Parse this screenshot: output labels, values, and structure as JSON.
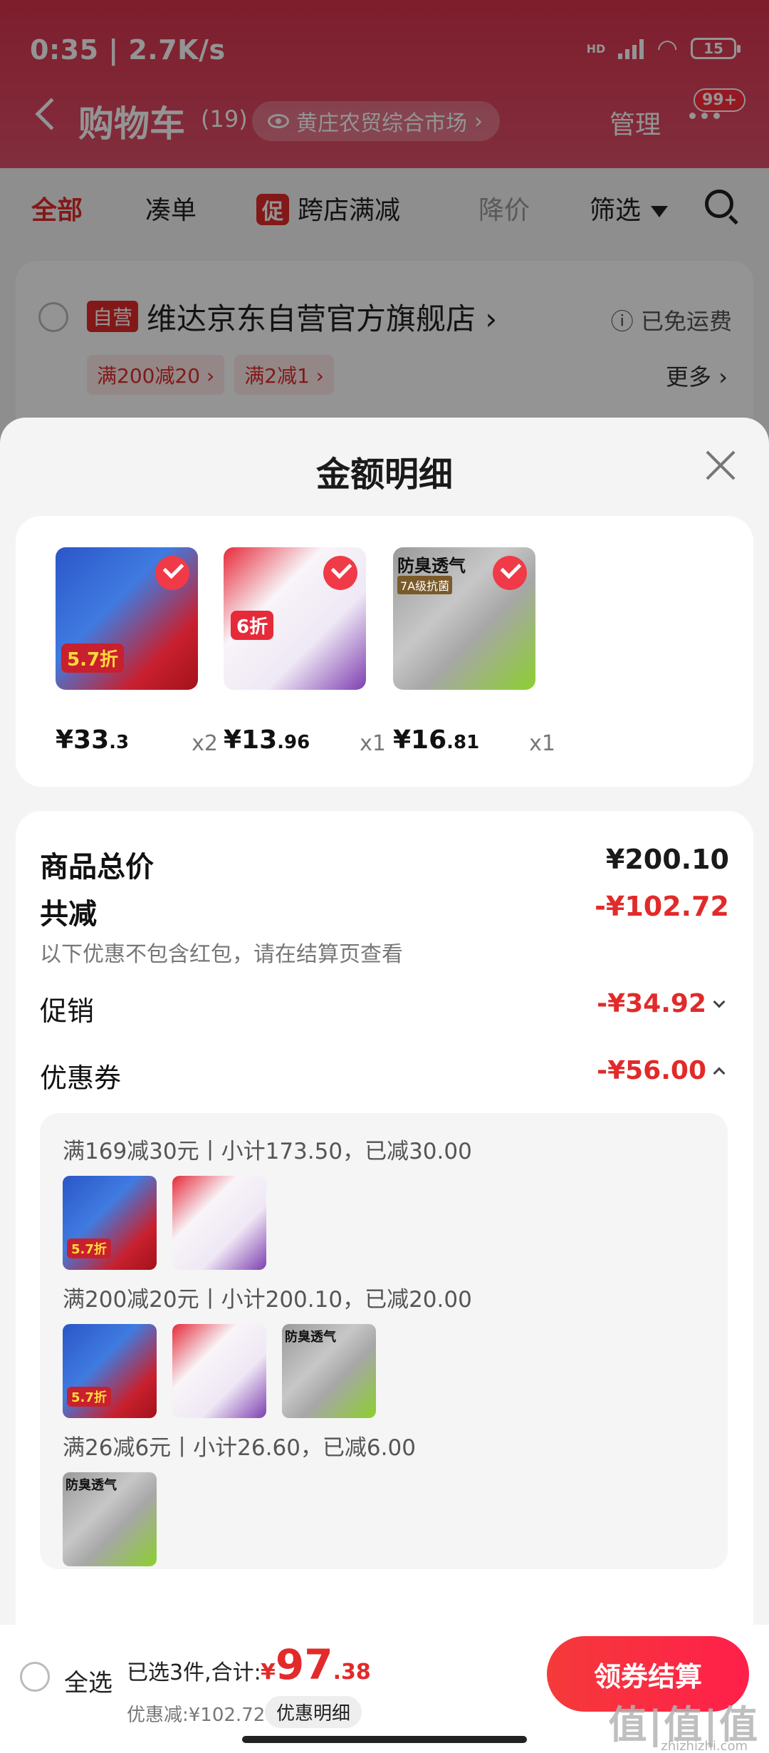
{
  "status": {
    "time": "0:35 | 2.7K/s",
    "network": "HD",
    "battery": "15"
  },
  "header": {
    "title": "购物车",
    "count": "(19)",
    "market": "黄庄农贸综合市场",
    "manage": "管理",
    "badge": "99+"
  },
  "filters": {
    "all": "全部",
    "bundle": "凑单",
    "promo_tag": "促",
    "cross_store": "跨店满减",
    "price_drop": "降价",
    "filter": "筛选"
  },
  "store": {
    "badge": "自营",
    "name": "维达京东自营官方旗舰店",
    "shipping": "已免运费",
    "chips": [
      "满200减20",
      "满2减1"
    ],
    "more": "更多"
  },
  "sheet": {
    "title": "金额明细"
  },
  "items": [
    {
      "price_int": "¥33",
      "price_dec": ".3",
      "qty": "x2",
      "badge_text": "5.7折"
    },
    {
      "price_int": "¥13",
      "price_dec": ".96",
      "qty": "x1",
      "badge_text": "6折"
    },
    {
      "price_int": "¥16",
      "price_dec": ".81",
      "qty": "x1",
      "label": "防臭透气",
      "sub": "7A级抗菌"
    }
  ],
  "detail": {
    "goods_total_label": "商品总价",
    "goods_total": "¥200.10",
    "total_off_label": "共减",
    "total_off": "-¥102.72",
    "note": "以下优惠不包含红包，请在结算页查看",
    "promo_label": "促销",
    "promo_value": "-¥34.92",
    "coupon_label": "优惠券",
    "coupon_value": "-¥56.00"
  },
  "coupons": [
    {
      "text": "满169减30元丨小计173.50，已减30.00"
    },
    {
      "text": "满200减20元丨小计200.10，已减20.00"
    },
    {
      "text": "满26减6元丨小计26.60，已减6.00"
    }
  ],
  "bottom": {
    "select_all": "全选",
    "summary": "已选3件,合计:",
    "currency": "¥",
    "total_int": "97",
    "total_dec": ".38",
    "saved": "优惠减:¥102.72",
    "detail_btn": "优惠明细",
    "checkout": "领券结算"
  },
  "watermark": {
    "main": "值|值|值",
    "site": "zhizhizhi.com"
  },
  "colors": {
    "brand_red": "#e22a2a",
    "header_top": "#d9334d"
  }
}
